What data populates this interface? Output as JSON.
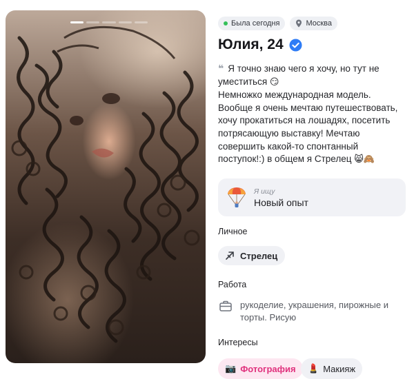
{
  "profile": {
    "status": "Была сегодня",
    "city": "Москва",
    "name_age": "Юлия, 24",
    "bio": {
      "line1": "Я точно знаю чего я хочу, но тут не уместиться",
      "emoji1": "😏",
      "body": "Немножко международная модель. Вообще я очень мечтаю путешествовать, хочу прокатиться на лошадях, посетить потрясающую выставку! Мечтаю совершить какой-то спонтанный поступок!:) в общем я Стрелец",
      "emoji2": "😸🙈"
    }
  },
  "seeking": {
    "label": "Я ищу",
    "value": "Новый опыт"
  },
  "sections": {
    "personal": "Личное",
    "work": "Работа",
    "interests": "Интересы"
  },
  "zodiac": {
    "label": "Стрелец",
    "icon": "sagittarius-icon"
  },
  "work": {
    "text": "рукоделие, украшения, пирожные и торты. Рисую"
  },
  "interests": [
    {
      "label": "Фотография",
      "icon": "camera-icon"
    },
    {
      "label": "Макияж",
      "icon": "lipstick-icon"
    }
  ],
  "photo": {
    "story_count": 5,
    "active_index": 0
  },
  "colors": {
    "online": "#35c05a",
    "verified": "#2e7cf6",
    "interest_pink": "#e0317d",
    "chip_bg": "#eef0f4"
  }
}
